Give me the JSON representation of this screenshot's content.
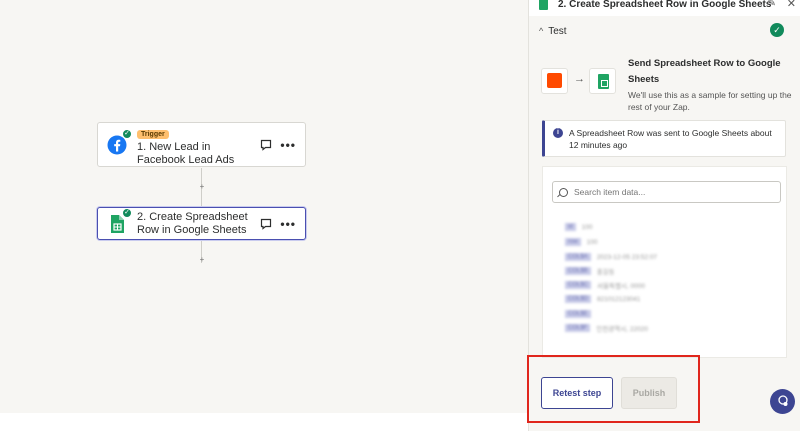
{
  "canvas": {
    "nodes": [
      {
        "badge": "Trigger",
        "title": "1. New Lead in Facebook Lead Ads",
        "app_icon": "facebook-icon",
        "status_icon": "check-icon"
      },
      {
        "badge": "",
        "title": "2. Create Spreadsheet Row in Google Sheets",
        "app_icon": "google-sheets-icon",
        "status_icon": "check-icon"
      }
    ],
    "add_step_symbol": "+",
    "more_symbol": "•••"
  },
  "panel": {
    "title": "2. Create Spreadsheet Row in Google Sheets",
    "section_label": "Test",
    "chevron": "^",
    "send_title": "Send Spreadsheet Row to Google Sheets",
    "send_desc": "We'll use this as a sample for setting up the rest of your Zap.",
    "notice": "A Spreadsheet Row was sent to Google Sheets about 12 minutes ago",
    "search_placeholder": "Search item data...",
    "data_rows": [
      {
        "key": "id",
        "value": "100"
      },
      {
        "key": "row",
        "value": "100"
      },
      {
        "key": "COL$A",
        "value": "2023-12-05 23:52:07"
      },
      {
        "key": "COL$B",
        "value": "홍길동"
      },
      {
        "key": "COL$C",
        "value": "서울특별시, 0000"
      },
      {
        "key": "COL$D",
        "value": "821012123041"
      },
      {
        "key": "COL$E",
        "value": ""
      },
      {
        "key": "COL$F",
        "value": "인천광역시, 22020"
      }
    ]
  },
  "buttons": {
    "retest": "Retest step",
    "publish": "Publish"
  },
  "colors": {
    "accent": "#3d4592",
    "success": "#118a5b",
    "zapier_orange": "#ff4a00",
    "sheets_green": "#1fa463",
    "highlight_red": "#e0261c"
  }
}
